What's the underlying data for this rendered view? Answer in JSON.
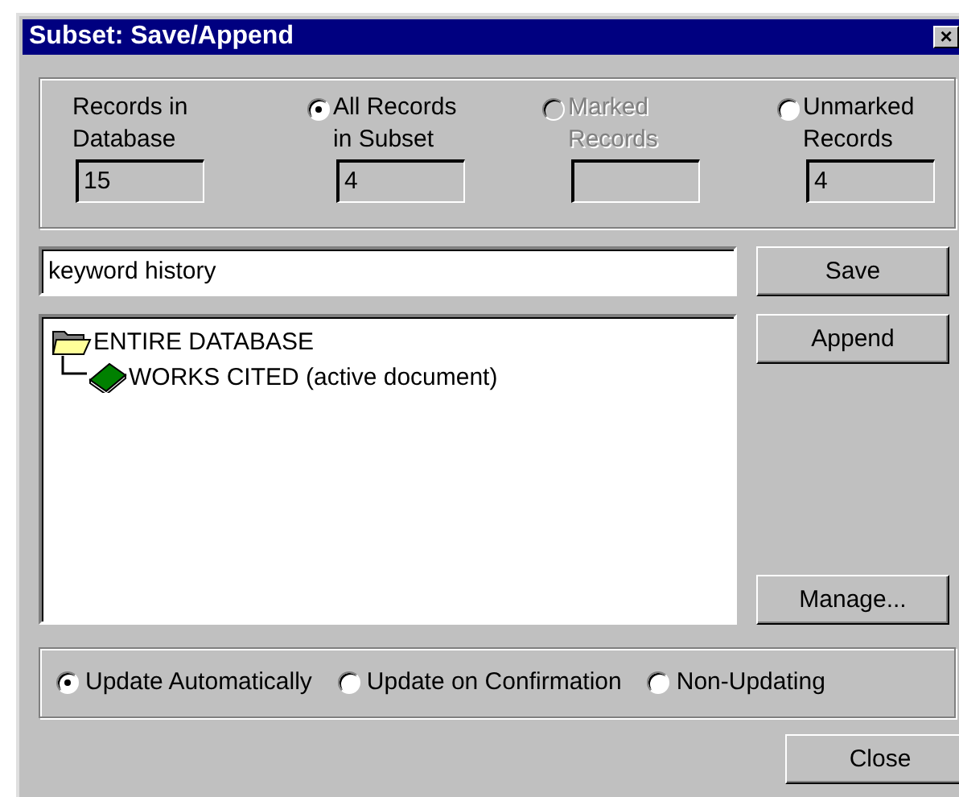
{
  "window": {
    "title": "Subset: Save/Append",
    "close": "×"
  },
  "counts": [
    {
      "kind": "static",
      "label": "Records in Database",
      "value": "15"
    },
    {
      "kind": "radio",
      "label": "All Records in Subset",
      "value": "4",
      "selected": true,
      "disabled": false
    },
    {
      "kind": "radio",
      "label": "Marked Records",
      "selected": false,
      "disabled": true
    },
    {
      "kind": "radio",
      "label": "Unmarked Records",
      "value": "4",
      "selected": false,
      "disabled": false
    }
  ],
  "name_field": {
    "value": "keyword history"
  },
  "tree": [
    {
      "label": "ENTIRE DATABASE",
      "kind": "folder",
      "children": [
        {
          "label": "WORKS CITED (active document)",
          "kind": "book"
        }
      ]
    }
  ],
  "side_buttons": [
    "Save",
    "Append"
  ],
  "manage_button": "Manage...",
  "update_modes": [
    {
      "label": "Update Automatically",
      "selected": true
    },
    {
      "label": "Update on Confirmation",
      "selected": false
    },
    {
      "label": "Non-Updating",
      "selected": false
    }
  ],
  "close_button": "Close"
}
